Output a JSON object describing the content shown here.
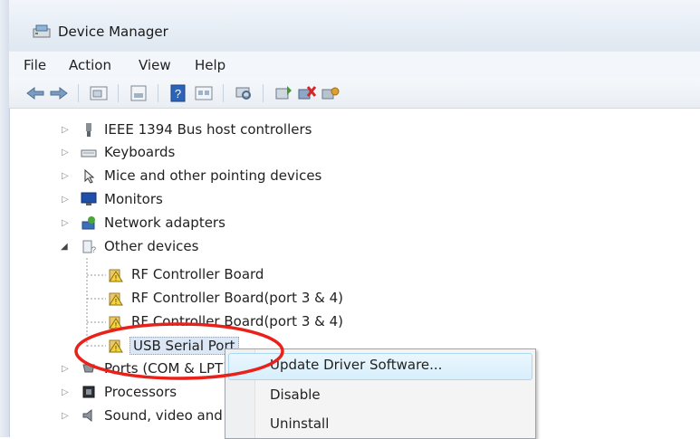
{
  "window": {
    "title": "Device Manager"
  },
  "menu": [
    "File",
    "Action",
    "View",
    "Help"
  ],
  "toolbar": {
    "icons": [
      "back-arrow-icon",
      "forward-arrow-icon",
      "show-hide-tree-icon",
      "properties-icon",
      "help-icon",
      "view-icon",
      "scan-hardware-icon",
      "update-driver-icon",
      "uninstall-icon",
      "disable-icon"
    ]
  },
  "tree": {
    "items": [
      {
        "label": "IEEE 1394 Bus host controllers",
        "expander": "▷",
        "icon": "ieee1394-icon"
      },
      {
        "label": "Keyboards",
        "expander": "▷",
        "icon": "keyboard-icon"
      },
      {
        "label": "Mice and other pointing devices",
        "expander": "▷",
        "icon": "mouse-icon"
      },
      {
        "label": "Monitors",
        "expander": "▷",
        "icon": "monitor-icon"
      },
      {
        "label": "Network adapters",
        "expander": "▷",
        "icon": "network-adapter-icon"
      },
      {
        "label": "Other devices",
        "expander": "◢",
        "icon": "other-devices-icon"
      },
      {
        "label": "RF Controller Board",
        "child": true,
        "icon": "warning-device-icon"
      },
      {
        "label": "RF Controller Board(port 3 & 4)",
        "child": true,
        "icon": "warning-device-icon"
      },
      {
        "label": "RF Controller Board(port 3 & 4)",
        "child": true,
        "icon": "warning-device-icon"
      },
      {
        "label": "USB Serial Port",
        "child": true,
        "icon": "warning-device-icon"
      },
      {
        "label": "Ports (COM & LPT)",
        "expander": "▷",
        "icon": "port-icon"
      },
      {
        "label": "Processors",
        "expander": "▷",
        "icon": "processor-icon"
      },
      {
        "label": "Sound, video and game controllers",
        "expander": "▷",
        "icon": "sound-icon"
      }
    ]
  },
  "context_menu": {
    "items": [
      "Update Driver Software...",
      "Disable",
      "Uninstall"
    ],
    "highlighted": "Update Driver Software..."
  },
  "annotation": {
    "color": "#e8221b"
  }
}
